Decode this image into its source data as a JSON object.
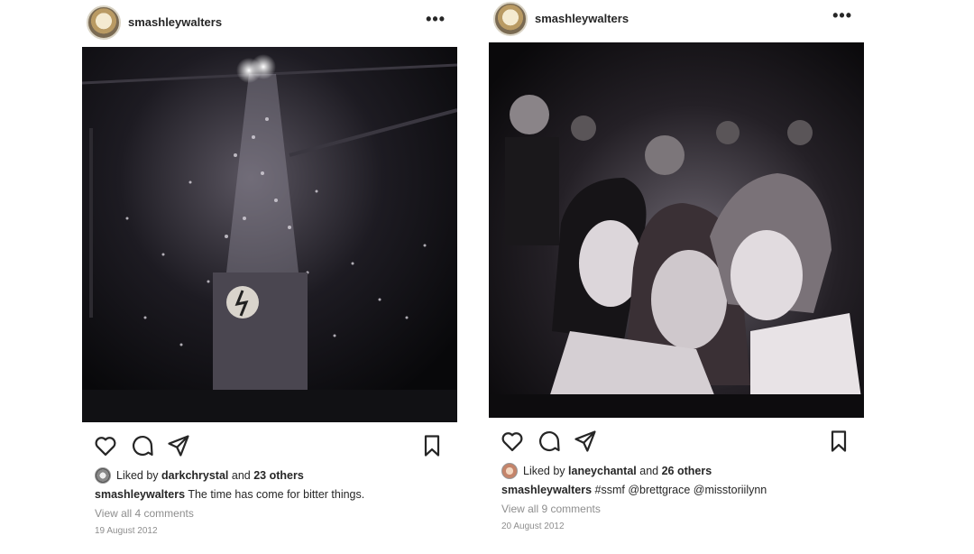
{
  "posts": [
    {
      "username": "smashleywalters",
      "liked_by_prefix": "Liked by",
      "liked_by_user": "darkchrystal",
      "liked_by_and": "and",
      "liked_by_others": "23 others",
      "caption_user": "smashleywalters",
      "caption_text": "The time has come for bitter things.",
      "comments_link": "View all 4 comments",
      "date": "19 August 2012"
    },
    {
      "username": "smashleywalters",
      "liked_by_prefix": "Liked by",
      "liked_by_user": "laneychantal",
      "liked_by_and": "and",
      "liked_by_others": "26 others",
      "caption_user": "smashleywalters",
      "caption_text": "#ssmf @brettgrace @misstoriilynn",
      "comments_link": "View all 9 comments",
      "date": "20 August 2012"
    }
  ],
  "icons": {
    "more": "more-options-icon",
    "like": "heart-icon",
    "comment": "comment-icon",
    "share": "send-icon",
    "save": "bookmark-icon"
  }
}
